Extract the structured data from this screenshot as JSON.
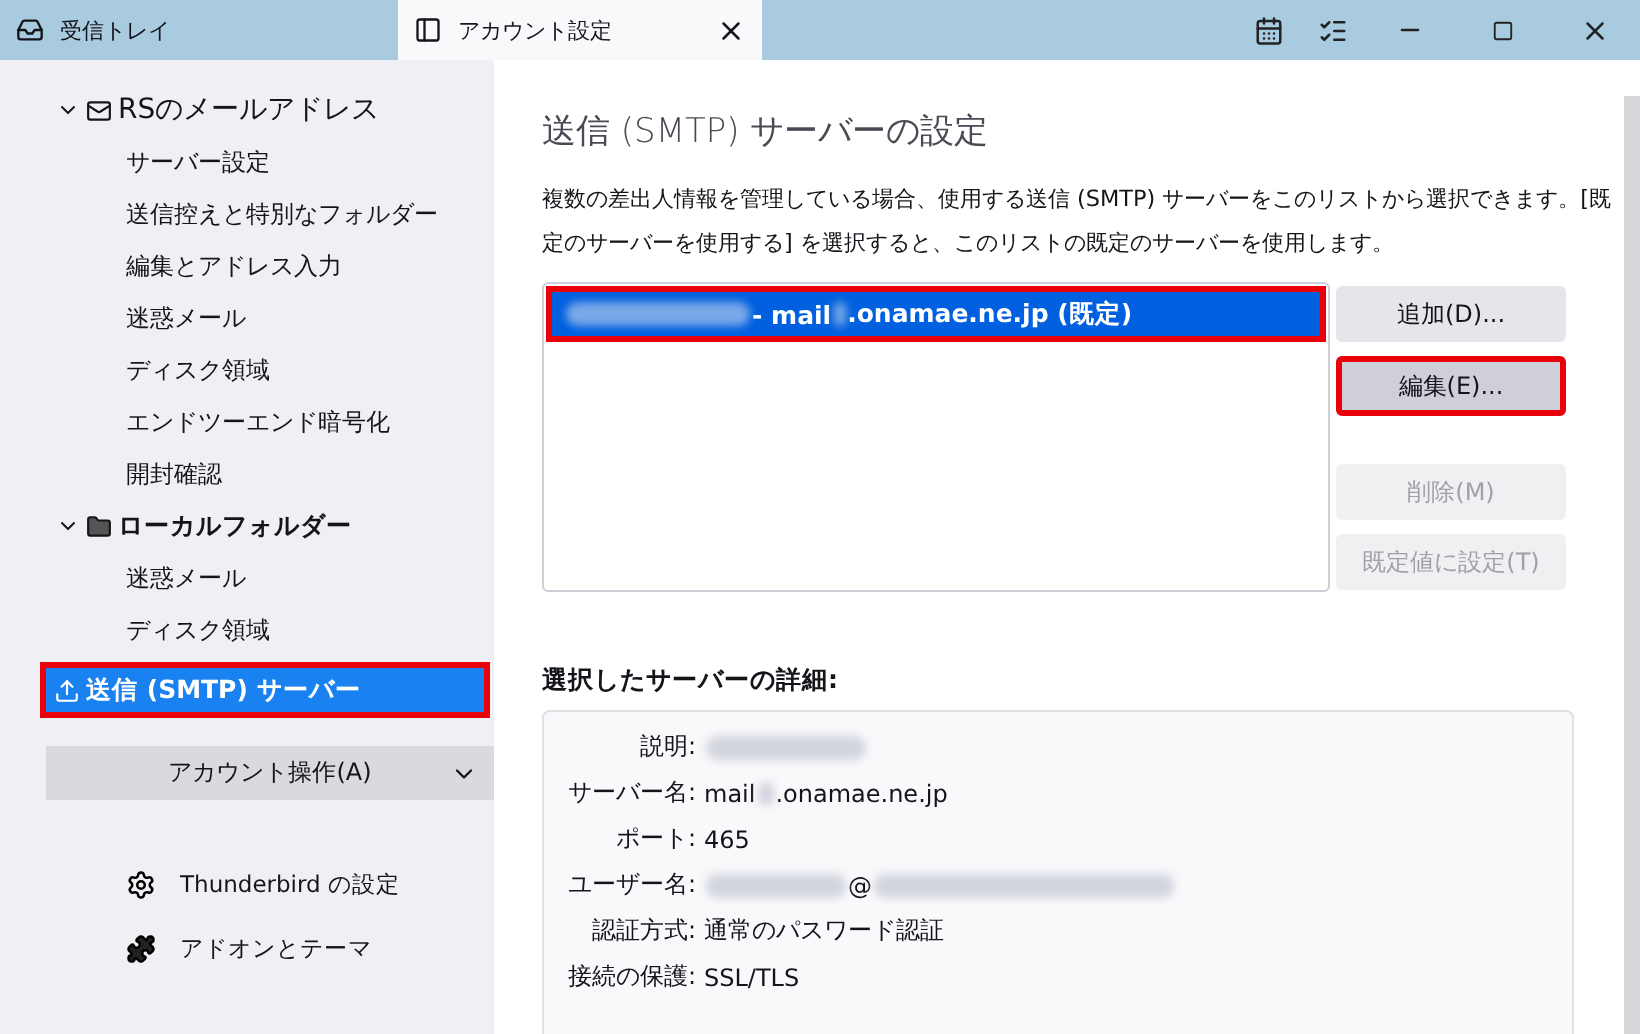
{
  "tabs": [
    {
      "label": "受信トレイ",
      "selected": false
    },
    {
      "label": "アカウント設定",
      "selected": true
    }
  ],
  "sidebar": {
    "accounts": [
      {
        "name": "RSのメールアドレス",
        "expanded": true,
        "items": [
          {
            "label": "サーバー設定",
            "selected": false
          },
          {
            "label": "送信控えと特別なフォルダー",
            "selected": false
          },
          {
            "label": "編集とアドレス入力",
            "selected": false
          },
          {
            "label": "迷惑メール",
            "selected": false
          },
          {
            "label": "ディスク領域",
            "selected": false
          },
          {
            "label": "エンドツーエンド暗号化",
            "selected": false
          },
          {
            "label": "開封確認",
            "selected": false
          }
        ]
      },
      {
        "name": "ローカルフォルダー",
        "expanded": true,
        "items": [
          {
            "label": "迷惑メール",
            "selected": false
          },
          {
            "label": "ディスク領域",
            "selected": false
          }
        ]
      }
    ],
    "smtp_item": {
      "label": "送信 (SMTP) サーバー",
      "selected": true,
      "highlighted": true
    },
    "account_actions": "アカウント操作(A)",
    "footer": [
      {
        "label": "Thunderbird の設定"
      },
      {
        "label": "アドオンとテーマ"
      }
    ]
  },
  "main": {
    "title": "送信 (SMTP) サーバーの設定",
    "description": "複数の差出人情報を管理している場合、使用する送信 (SMTP) サーバーをこのリストから選択できます。[既定のサーバーを使用する] を選択すると、このリストの既定のサーバーを使用します。",
    "servers": [
      {
        "parts": [
          {
            "kind": "blur"
          },
          {
            "kind": "text",
            "text": "- mail"
          },
          {
            "kind": "blur"
          },
          {
            "kind": "text",
            "text": ".onamae.ne.jp (既定)"
          }
        ],
        "selected": true,
        "highlighted": true
      }
    ],
    "buttons": [
      {
        "label": "追加(D)...",
        "disabled": false,
        "highlighted": false
      },
      {
        "label": "編集(E)...",
        "disabled": false,
        "highlighted": true
      },
      {
        "label": "削除(M)",
        "disabled": true,
        "highlighted": false
      },
      {
        "label": "既定値に設定(T)",
        "disabled": true,
        "highlighted": false
      }
    ],
    "details_title": "選択したサーバーの詳細:",
    "details": [
      {
        "label": "説明:",
        "parts": [
          {
            "kind": "blur"
          }
        ]
      },
      {
        "label": "サーバー名:",
        "parts": [
          {
            "kind": "text",
            "text": "mail"
          },
          {
            "kind": "blur"
          },
          {
            "kind": "text",
            "text": ".onamae.ne.jp"
          }
        ]
      },
      {
        "label": "ポート:",
        "parts": [
          {
            "kind": "text",
            "text": "465"
          }
        ]
      },
      {
        "label": "ユーザー名:",
        "parts": [
          {
            "kind": "blur"
          },
          {
            "kind": "text",
            "text": "@"
          },
          {
            "kind": "blur"
          }
        ]
      },
      {
        "label": "認証方式:",
        "parts": [
          {
            "kind": "text",
            "text": "通常のパスワード認証"
          }
        ]
      },
      {
        "label": "接続の保護:",
        "parts": [
          {
            "kind": "text",
            "text": "SSL/TLS"
          }
        ]
      }
    ]
  }
}
